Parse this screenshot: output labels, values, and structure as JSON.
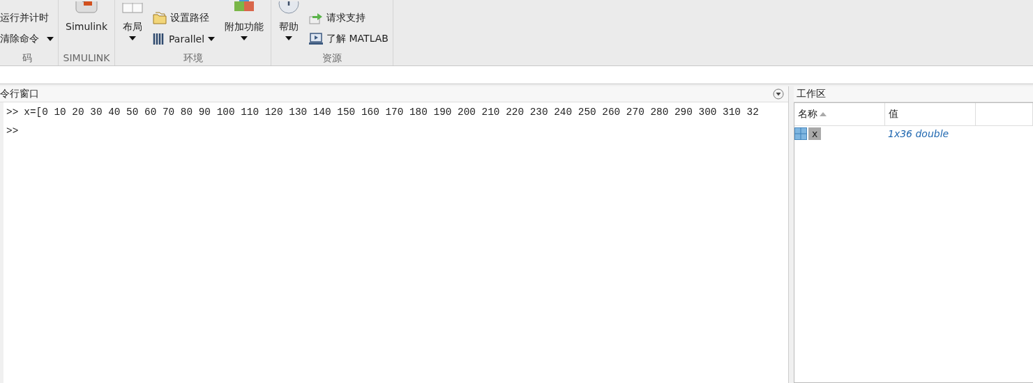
{
  "ribbon": {
    "groups": [
      {
        "label": "码",
        "items": [
          {
            "kind": "small",
            "label": "运行并计时",
            "dropdown": false
          },
          {
            "kind": "small",
            "label": "清除命令",
            "dropdown": true
          }
        ]
      },
      {
        "label": "SIMULINK",
        "items": [
          {
            "kind": "large",
            "label": "Simulink",
            "dropdown": false
          }
        ]
      },
      {
        "label": "环境",
        "items": [
          {
            "kind": "large",
            "label": "布局",
            "dropdown": true
          },
          {
            "kind": "stack",
            "children": [
              {
                "label": "设置路径",
                "dropdown": false
              },
              {
                "label": "Parallel",
                "dropdown": true
              }
            ]
          },
          {
            "kind": "large",
            "label": "附加功能",
            "dropdown": true
          }
        ]
      },
      {
        "label": "资源",
        "items": [
          {
            "kind": "large",
            "label": "帮助",
            "dropdown": true
          },
          {
            "kind": "stack",
            "children": [
              {
                "label": "请求支持",
                "dropdown": false
              },
              {
                "label": "了解 MATLAB",
                "dropdown": false
              }
            ]
          }
        ]
      }
    ]
  },
  "command_window": {
    "title": "令行窗口",
    "lines": [
      {
        "prompt": ">>",
        "text": "x=[0 10 20 30 40 50 60 70 80 90 100 110 120 130 140 150 160 170 180 190 200 210 220 230 240 250 260 270 280 290 300 310 32"
      },
      {
        "prompt": ">>"
      }
    ]
  },
  "workspace": {
    "title": "工作区",
    "columns": [
      {
        "label": "名称",
        "sorted": true
      },
      {
        "label": "值",
        "sorted": false
      }
    ],
    "rows": [
      {
        "name": "x",
        "value": "1x36 double",
        "selected": true
      }
    ]
  }
}
